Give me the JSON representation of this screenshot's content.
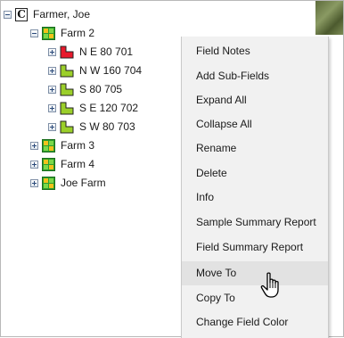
{
  "tree": {
    "root": {
      "label": "Farmer, Joe",
      "icon": "customer-c-icon",
      "glyph": "C"
    },
    "farms": [
      {
        "label": "Farm 2",
        "expanded": true,
        "fields": [
          {
            "label": "N E 80 701",
            "color": "#e8192c"
          },
          {
            "label": "N W 160 704",
            "color": "#9bcf2a"
          },
          {
            "label": "S 80 705",
            "color": "#9bcf2a"
          },
          {
            "label": "S E 120 702",
            "color": "#9bcf2a"
          },
          {
            "label": "S W 80 703",
            "color": "#9bcf2a"
          }
        ]
      },
      {
        "label": "Farm 3",
        "expanded": false
      },
      {
        "label": "Farm 4",
        "expanded": false
      },
      {
        "label": "Joe Farm",
        "expanded": false
      }
    ],
    "farm_icon_color": "#2e9e2e",
    "farm_icon_accent": "#f2c21a"
  },
  "context_menu": {
    "items": [
      "Field Notes",
      "Add Sub-Fields",
      "Expand All",
      "Collapse All",
      "Rename",
      "Delete",
      "Info",
      "Sample Summary Report",
      "Field Summary Report",
      "Move To",
      "Copy To",
      "Change Field Color"
    ],
    "hovered": "Move To"
  },
  "cursor": {
    "icon": "hand-pointer-icon"
  }
}
